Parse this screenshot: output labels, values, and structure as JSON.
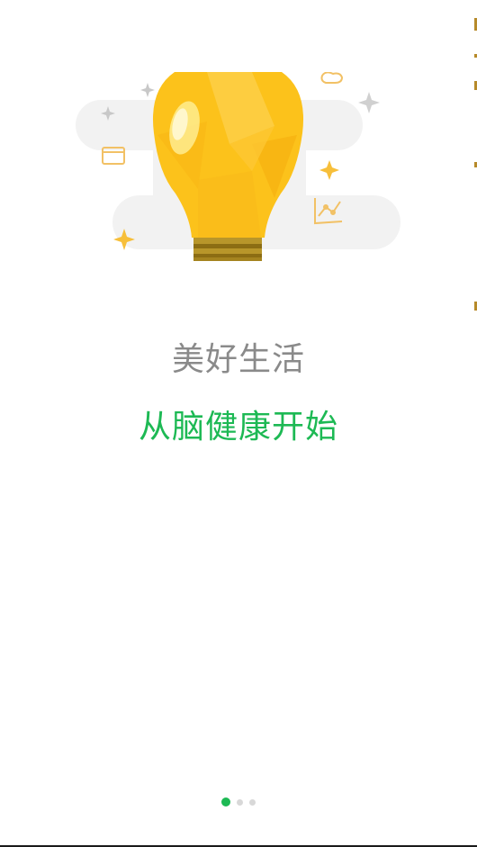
{
  "onboarding": {
    "title": "美好生活",
    "subtitle": "从脑健康开始",
    "illustration_icon": "lightbulb-icon",
    "pager": {
      "total_pages": 3,
      "current_page": 1
    }
  },
  "colors": {
    "accent": "#1db954",
    "title_gray": "#8a8a8a",
    "bulb_yellow": "#fcc21b",
    "sparkle_yellow": "#f7bf3a",
    "cloud_gray": "#f2f2f2"
  }
}
